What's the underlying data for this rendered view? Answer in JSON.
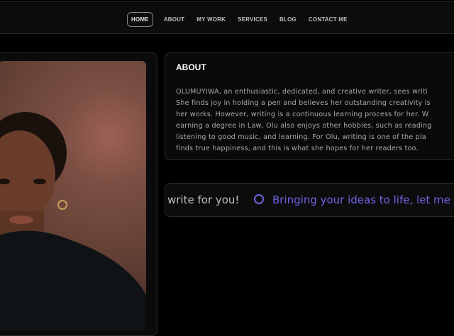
{
  "nav": {
    "items": [
      "HOME",
      "ABOUT",
      "MY WORK",
      "SERVICES",
      "BLOG",
      "CONTACT ME"
    ],
    "active": "HOME"
  },
  "about": {
    "title": "ABOUT",
    "lines": [
      "OLUMUYIWA, an enthusiastic, dedicated, and creative writer, sees writi",
      "She finds joy in holding a pen and believes her outstanding creativity is",
      "her works. However, writing is a continuous learning process for her. W",
      "earning a degree in Law, Olu also enjoys other hobbies, such as reading",
      "listening to good music, and learning. For Olu, writing is one of the pla",
      "finds true happiness, and this is what she hopes for her readers too."
    ]
  },
  "ticker": {
    "text_a": "write for you!",
    "text_b": "Bringing your ideas to life, let me",
    "accent_color": "#6d66e6",
    "circle_icon": "circle-icon"
  },
  "colors": {
    "background": "#000000",
    "card_border": "#2b2b2b",
    "photo_background": "#7b4f43"
  }
}
